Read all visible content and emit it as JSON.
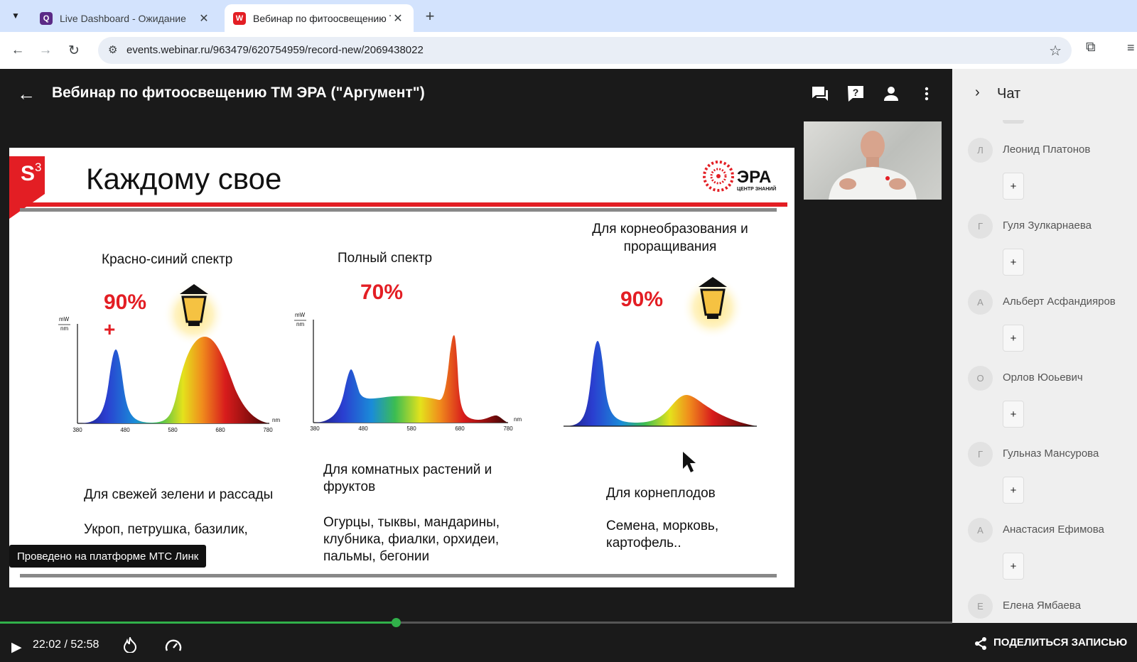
{
  "browser": {
    "tabs": [
      {
        "title": "Live Dashboard - Ожидание",
        "favicon": "dashboard-favicon"
      },
      {
        "title": "Вебинар по фитоосвещению ТМ ЭРА",
        "favicon": "webinar-favicon"
      }
    ],
    "url": "events.webinar.ru/963479/620754959/record-new/2069438022"
  },
  "player": {
    "title": "Вебинар по фитоосвещению ТМ ЭРА (\"Аргумент\")",
    "platform_badge": "Проведено на платформе МТС Линк",
    "time": "22:02 / 52:58",
    "progress": 0.416,
    "accent_color": "#31b04a"
  },
  "slide": {
    "logo_letter": "S",
    "logo_sup": "3",
    "title": "Каждому свое",
    "brand": "ЭРА",
    "brand_sub": "ЦЕНТР ЗНАНИЙ",
    "units_y": [
      "mW",
      "nm"
    ],
    "units_x": "nm",
    "columns": [
      {
        "heading": "Красно-синий спектр",
        "percent": "90%",
        "plus": "+",
        "ticks": [
          "380",
          "480",
          "580",
          "680",
          "780"
        ],
        "caption": "Для свежей зелени и рассады",
        "examples": "Укроп, петрушка, базилик,"
      },
      {
        "heading": "Полный спектр",
        "percent": "70%",
        "ticks": [
          "380",
          "480",
          "580",
          "680",
          "780"
        ],
        "caption": "Для комнатных растений и фруктов",
        "examples": "Огурцы, тыквы, мандарины, клубника, фиалки, орхидеи, пальмы, бегонии"
      },
      {
        "heading": "Для корнеобразования и проращивания",
        "percent": "90%",
        "caption": "Для корнеплодов",
        "examples": "Семена, морковь, картофель.."
      }
    ]
  },
  "chat": {
    "title": "Чат",
    "messages": [
      {
        "initial": "Л",
        "name": "Леонид Платонов",
        "reaction": "+"
      },
      {
        "initial": "Г",
        "name": "Гуля Зулкарнаева",
        "reaction": "+"
      },
      {
        "initial": "А",
        "name": "Альберт Асфандияров",
        "reaction": "+"
      },
      {
        "initial": "О",
        "name": "Орлов Юоьевич",
        "reaction": "+"
      },
      {
        "initial": "Г",
        "name": "Гульназ Мансурова",
        "reaction": "+"
      },
      {
        "initial": "А",
        "name": "Анастасия Ефимова",
        "reaction": "+"
      },
      {
        "initial": "Е",
        "name": "Елена Ямбаева"
      }
    ],
    "share_label": "ПОДЕЛИТЬСЯ ЗАПИСЬЮ"
  }
}
